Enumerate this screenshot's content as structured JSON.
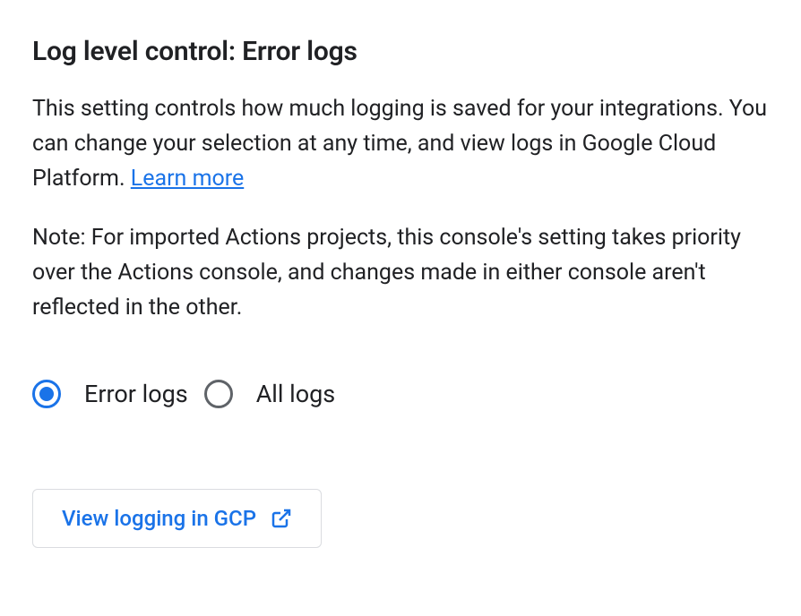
{
  "heading": "Log level control: Error logs",
  "description_part1": "This setting controls how much logging is saved for your integrations. You can change your selection at any time, and view logs in Google Cloud Platform. ",
  "learn_more": "Learn more",
  "note": "Note: For imported Actions projects, this console's setting takes priority over the Actions console, and changes made in either console aren't reflected in the other.",
  "radio_options": {
    "error_logs": "Error logs",
    "all_logs": "All logs"
  },
  "gcp_button": "View logging in GCP",
  "colors": {
    "link": "#1a73e8",
    "text": "#202124",
    "border": "#dadce0",
    "radio_unselected": "#5f6368"
  }
}
